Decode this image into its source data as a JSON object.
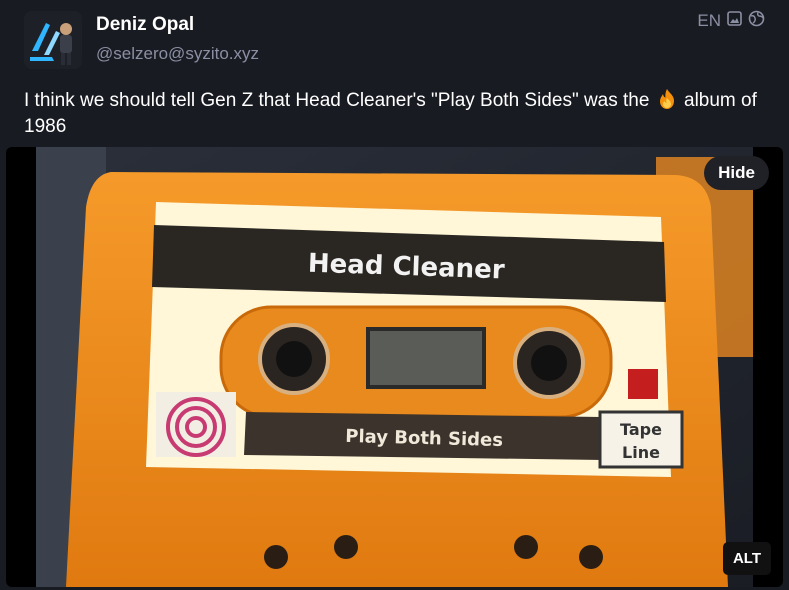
{
  "post": {
    "author_name": "Deniz Opal",
    "author_handle": "@selzero@syzito.xyz",
    "language": "EN",
    "text_before": "I think we should tell Gen Z that Head Cleaner's \"Play Both Sides\" was the ",
    "text_after": " album of 1986",
    "emoji_icon": "fire-emoji"
  },
  "media": {
    "hide_label": "Hide",
    "alt_label": "ALT",
    "cassette": {
      "title": "Head Cleaner",
      "side_label": "Play Both Sides",
      "logo_text_top": "Tape",
      "logo_text_bottom": "Line",
      "body_color": "#f08a1c",
      "label_color": "#fff7d8"
    }
  },
  "icons": {
    "media_icon": "image-icon",
    "visibility_icon": "globe-icon"
  }
}
